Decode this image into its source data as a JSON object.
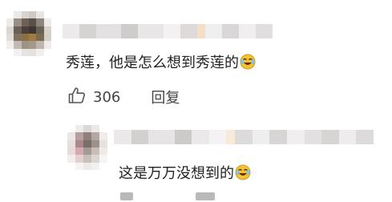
{
  "comment": {
    "text": "秀莲，他是怎么想到秀莲的",
    "emoji": "laughing-crying-emoji",
    "likes": "306",
    "reply_label": "回复"
  },
  "reply": {
    "text": "这是万万没想到的",
    "emoji": "laughing-crying-emoji"
  },
  "colors": {
    "icon": "#555555",
    "text": "#222222",
    "secondary": "#444444",
    "emoji_face": "#f5c236"
  }
}
